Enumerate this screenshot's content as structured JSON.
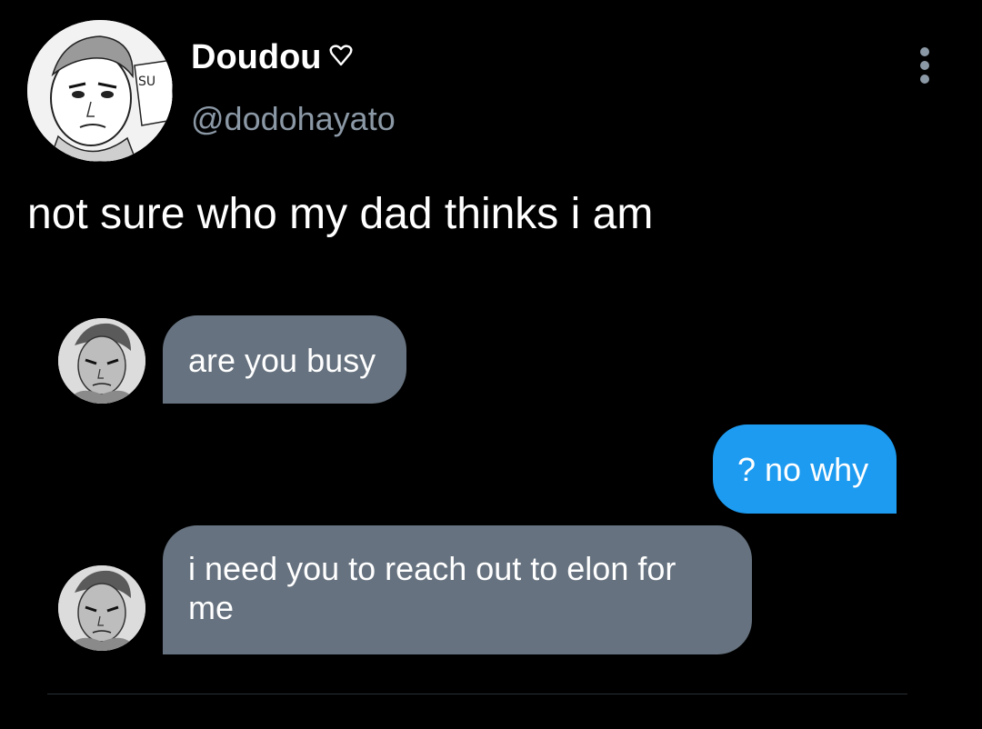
{
  "author": {
    "display_name": "Doudou",
    "handle": "@dodohayato",
    "avatar_caption": "SU"
  },
  "tweet": {
    "text": "not sure who my dad thinks i am"
  },
  "conversation": {
    "messages": [
      {
        "sender": "dad",
        "text": "are you busy"
      },
      {
        "sender": "me",
        "text": "? no why"
      },
      {
        "sender": "dad",
        "text": "i need you to reach out to elon for me"
      }
    ]
  },
  "icons": {
    "verified_like": "heart-outline-icon",
    "menu": "more-options-icon"
  },
  "colors": {
    "background": "#000000",
    "incoming_bubble": "#66727f",
    "outgoing_bubble": "#1d9bf0",
    "secondary_text": "#8b98a5"
  }
}
